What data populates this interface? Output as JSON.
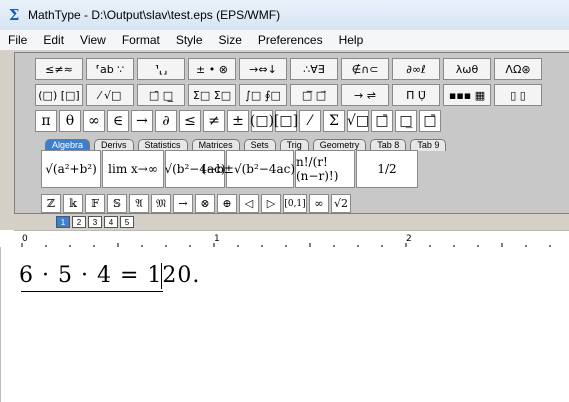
{
  "window": {
    "title": "MathType - D:\\Output\\slav\\test.eps (EPS/WMF)"
  },
  "menu": [
    "File",
    "Edit",
    "View",
    "Format",
    "Style",
    "Size",
    "Preferences",
    "Help"
  ],
  "palettes_row1": [
    "≤≠≈",
    "⸢ab ∵",
    "⸣⸤⸥",
    "± • ⊗",
    "→⇔↓",
    "∴∀∃",
    "∉∩⊂",
    "∂∞ℓ",
    "λωθ",
    "ΛΩ⊛"
  ],
  "palettes_row2": [
    "(□) [□]",
    "⁄ √□",
    "□̄ □̲",
    "Σ□ Σ□",
    "∫□ ∮□",
    "□̅ □⃗",
    "→ ⇌",
    "Π̈ Ụ̈",
    "▪▪▪ ▦",
    "▯ ▯"
  ],
  "symbols_row": [
    "π",
    "θ",
    "∞",
    "∈",
    "→",
    "∂",
    "≤",
    "≠",
    "±",
    "(□)",
    "[□]",
    "⁄",
    "Σ",
    "√□",
    "□̄",
    "□̲",
    "□̄"
  ],
  "tabs": [
    "Algebra",
    "Derivs",
    "Statistics",
    "Matrices",
    "Sets",
    "Trig",
    "Geometry",
    "Tab 8",
    "Tab 9"
  ],
  "templates": [
    "√(a²+b²)",
    "lim x→∞",
    "√(b²−4ac)",
    "(−b±√(b²−4ac))/2a",
    "n!/(r!(n−r)!)",
    "1/2"
  ],
  "small_row": [
    "ℤ",
    "𝕜",
    "𝔽",
    "𝕊",
    "𝔄",
    "𝔐",
    "→",
    "⊗",
    "⊕",
    "◁",
    "▷",
    "[0,1]",
    "∞",
    "√2"
  ],
  "style_buttons": [
    "1",
    "2",
    "3",
    "4",
    "5"
  ],
  "equation": "6 · 5 · 4 = 120."
}
